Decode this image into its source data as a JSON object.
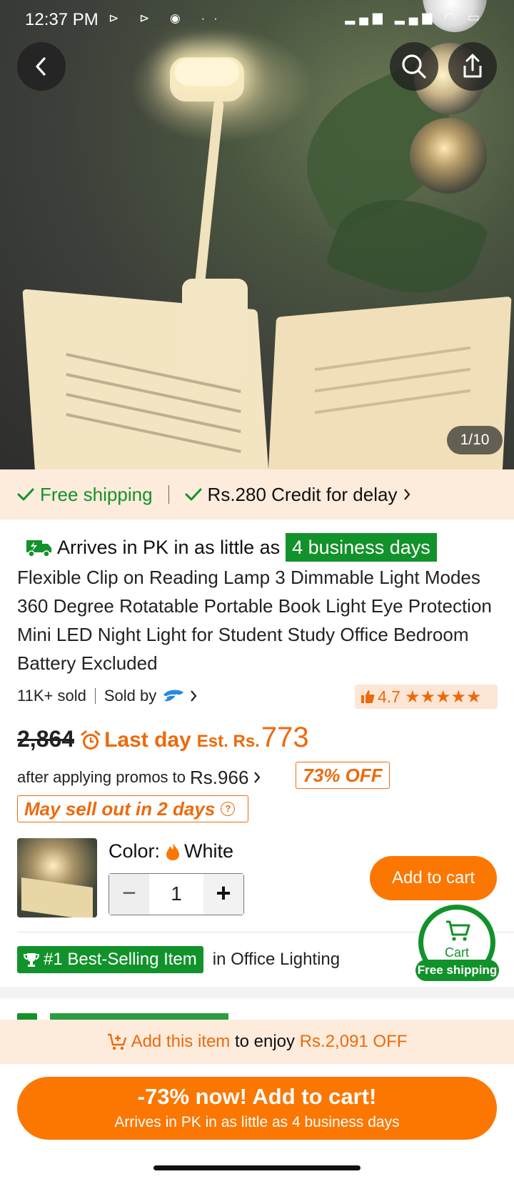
{
  "status_bar": {
    "time": "12:37 PM",
    "left_icons": "⊳ ⊳ ◉ ··",
    "right_icons": "▂▄▆ ▂▄▆ ◠ ▭"
  },
  "gallery": {
    "counter": "1/10"
  },
  "shipping": {
    "free": "Free shipping",
    "credit": "Rs.280 Credit for delay"
  },
  "arrives": {
    "prefix": "Arrives in PK in as little as",
    "days": "4 business days"
  },
  "product": {
    "title": "Flexible Clip on Reading Lamp 3 Dimmable Light Modes 360 Degree Rotatable Portable Book Light Eye Protection Mini LED Night Light for Student Study Office Bedroom Battery Excluded",
    "sold": "11K+ sold",
    "sold_by": "Sold by",
    "rating": "4.7",
    "stars": "★★★★★"
  },
  "price": {
    "original": "2,864",
    "last_day": "Last day",
    "est_label": "Est. Rs.",
    "est_value": "773",
    "promo_prefix": "after applying promos to",
    "promo_price": "Rs.966",
    "off": "73% OFF",
    "sellout": "May sell out in 2 days"
  },
  "variant": {
    "color_label": "Color:",
    "color_value": "White",
    "quantity": "1",
    "minus": "−",
    "plus": "+",
    "add_to_cart": "Add to cart"
  },
  "best_seller": {
    "badge": "#1 Best-Selling Item",
    "category": "in Office Lighting"
  },
  "cart_float": {
    "label": "Cart",
    "shipping": "Free shipping"
  },
  "promo_banner": {
    "part1": "Add this item",
    "part2": "to enjoy",
    "part3": "Rs.2,091 OFF"
  },
  "cta": {
    "line1": "-73% now! Add to cart!",
    "line2": "Arrives in PK in as little as 4 business days"
  },
  "colors": {
    "accent": "#fb7701",
    "green": "#12922a",
    "peach": "#fdebdc"
  }
}
